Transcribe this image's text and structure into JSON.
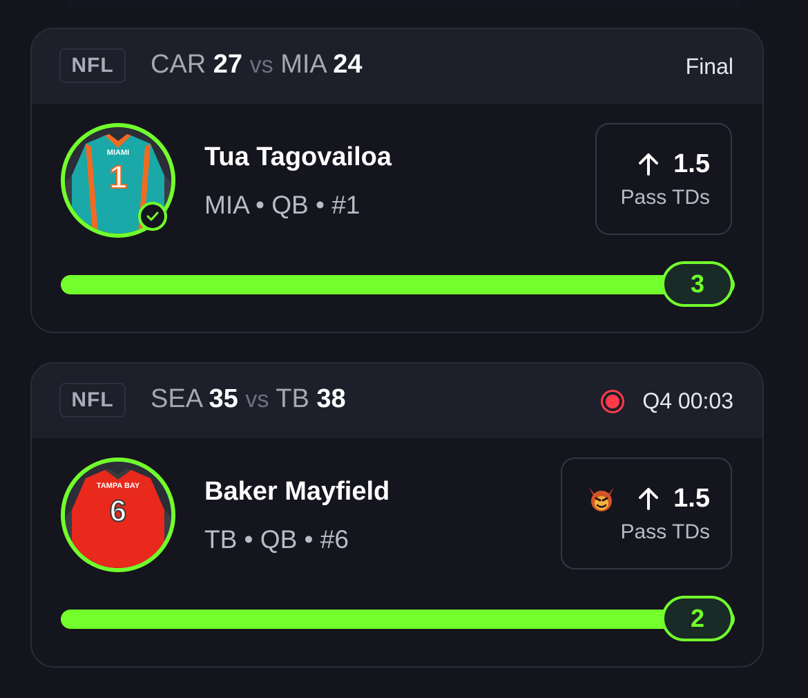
{
  "colors": {
    "accent": "#72ff2c",
    "live": "#ff3b4a",
    "background": "#13141c",
    "card_header": "#1d1f2a"
  },
  "cards": [
    {
      "league": "NFL",
      "away_team": "CAR",
      "away_score": "27",
      "vs": "vs",
      "home_team": "MIA",
      "home_score": "24",
      "status": "Final",
      "live": false,
      "player": {
        "name": "Tua Tagovailoa",
        "meta": "MIA • QB • #1",
        "jersey_team": "MIAMI",
        "jersey_number": "1",
        "jersey_color": "#1aa8a8",
        "trim_color": "#f26a22",
        "hit": true
      },
      "pick": {
        "direction_icon": "arrow-up-icon",
        "line": "1.5",
        "stat": "Pass TDs",
        "demon": false
      },
      "progress": {
        "value": "3",
        "fraction": 1.0
      }
    },
    {
      "league": "NFL",
      "away_team": "SEA",
      "away_score": "35",
      "vs": "vs",
      "home_team": "TB",
      "home_score": "38",
      "status": "Q4 00:03",
      "live": true,
      "player": {
        "name": "Baker Mayfield",
        "meta": "TB • QB • #6",
        "jersey_team": "TAMPA BAY",
        "jersey_number": "6",
        "jersey_color": "#e8291c",
        "trim_color": "#3a3a3a",
        "hit": false
      },
      "pick": {
        "direction_icon": "arrow-up-icon",
        "line": "1.5",
        "stat": "Pass TDs",
        "demon": true
      },
      "progress": {
        "value": "2",
        "fraction": 1.0
      }
    }
  ]
}
